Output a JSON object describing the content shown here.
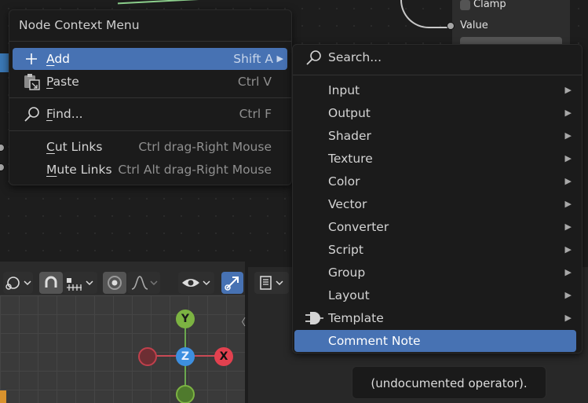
{
  "node": {
    "clamp_label": "Clamp",
    "value_label": "Value"
  },
  "context_menu": {
    "title": "Node Context Menu",
    "items": [
      {
        "label": "Add",
        "mnemonic": "A",
        "shortcut": "Shift A",
        "icon": "plus-icon",
        "highlighted": true,
        "has_submenu": true
      },
      {
        "label": "Paste",
        "mnemonic": "P",
        "shortcut": "Ctrl V",
        "icon": "paste-icon"
      },
      {
        "label": "Find...",
        "mnemonic": "F",
        "shortcut": "Ctrl F",
        "icon": "search-icon"
      },
      {
        "label": "Cut Links",
        "mnemonic": "C",
        "shortcut": "Ctrl drag-Right Mouse"
      },
      {
        "label": "Mute Links",
        "mnemonic": "M",
        "shortcut": "Ctrl Alt drag-Right Mouse"
      }
    ]
  },
  "add_submenu": {
    "search_label": "Search...",
    "items": [
      {
        "label": "Input",
        "has_submenu": true
      },
      {
        "label": "Output",
        "has_submenu": true
      },
      {
        "label": "Shader",
        "has_submenu": true
      },
      {
        "label": "Texture",
        "has_submenu": true
      },
      {
        "label": "Color",
        "has_submenu": true
      },
      {
        "label": "Vector",
        "has_submenu": true
      },
      {
        "label": "Converter",
        "has_submenu": true
      },
      {
        "label": "Script",
        "has_submenu": true
      },
      {
        "label": "Group",
        "has_submenu": true
      },
      {
        "label": "Layout",
        "has_submenu": true
      },
      {
        "label": "Template",
        "has_submenu": true,
        "icon": "plugin-icon"
      },
      {
        "label": "Comment Note",
        "has_submenu": false,
        "highlighted": true
      }
    ]
  },
  "viewport": {
    "gizmo": {
      "y": "Y",
      "x": "X",
      "z": "Z"
    }
  },
  "tooltip": "(undocumented operator).",
  "colors": {
    "highlight": "#4772b3",
    "menu_bg": "#1b1b1b",
    "axis_x": "#e2414f",
    "axis_y": "#7cb342",
    "axis_z": "#3d8fe0"
  }
}
